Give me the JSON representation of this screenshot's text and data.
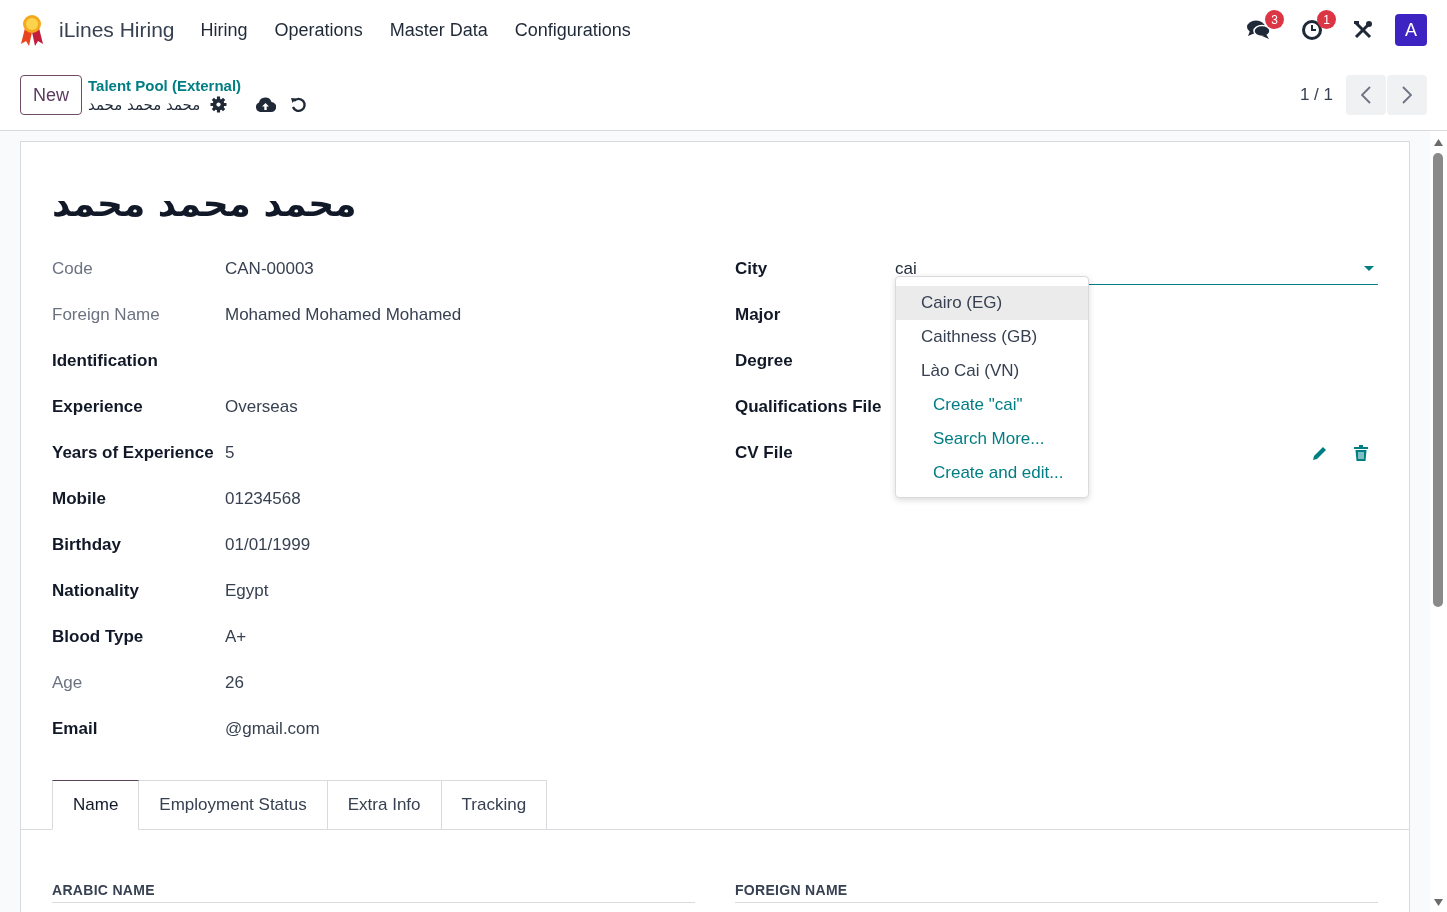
{
  "navbar": {
    "app_name": "iLines Hiring",
    "menus": [
      "Hiring",
      "Operations",
      "Master Data",
      "Configurations"
    ],
    "messages_badge": "3",
    "activities_badge": "1",
    "avatar": "A"
  },
  "control_panel": {
    "new_button": "New",
    "breadcrumb": "Talent Pool (External)",
    "record_name": "محمد محمد محمد",
    "pager": "1 / 1"
  },
  "form": {
    "title": "محمد محمد محمد",
    "left_fields": [
      {
        "label": "Code",
        "value": "CAN-00003",
        "readonly": true
      },
      {
        "label": "Foreign Name",
        "value": "Mohamed Mohamed Mohamed",
        "readonly": true
      },
      {
        "label": "Identification",
        "readonly": false
      },
      {
        "label": "Experience",
        "value": "Overseas",
        "readonly": false
      },
      {
        "label": "Years of Experience",
        "value": "5",
        "readonly": false
      },
      {
        "label": "Mobile",
        "value": "01234568",
        "readonly": false
      },
      {
        "label": "Birthday",
        "value": "01/01/1999",
        "readonly": false
      },
      {
        "label": "Nationality",
        "value": "Egypt",
        "readonly": false
      },
      {
        "label": "Blood Type",
        "value": "A+",
        "readonly": false
      },
      {
        "label": "Age",
        "value": "26",
        "readonly": true
      },
      {
        "label": "Email",
        "value": "@gmail.com",
        "readonly": false
      }
    ],
    "right_fields": [
      {
        "label": "City",
        "kind": "many2one",
        "value": "cai"
      },
      {
        "label": "Major",
        "kind": "empty"
      },
      {
        "label": "Degree",
        "kind": "empty"
      },
      {
        "label": "Qualifications File",
        "kind": "empty"
      },
      {
        "label": "CV File",
        "kind": "binary"
      }
    ],
    "city_dropdown": {
      "options": [
        {
          "label": "Cairo (EG)",
          "selected": true
        },
        {
          "label": "Caithness (GB)",
          "selected": false
        },
        {
          "label": "Lào Cai (VN)",
          "selected": false
        }
      ],
      "actions": [
        "Create \"cai\"",
        "Search More...",
        "Create and edit..."
      ]
    },
    "tabs": [
      {
        "label": "Name",
        "selected": true
      },
      {
        "label": "Employment Status",
        "selected": false
      },
      {
        "label": "Extra Info",
        "selected": false
      },
      {
        "label": "Tracking",
        "selected": false
      }
    ],
    "sections": [
      "ARABIC NAME",
      "FOREIGN NAME"
    ]
  }
}
